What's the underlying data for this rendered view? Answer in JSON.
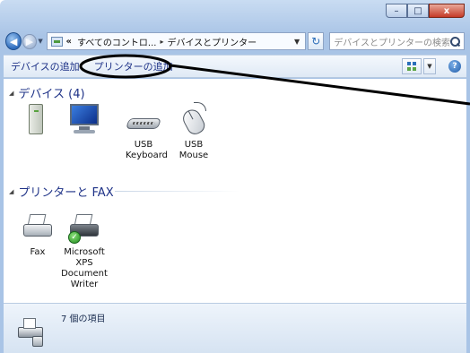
{
  "window": {
    "caption_buttons": {
      "minimize": "–",
      "maximize": "□",
      "close": "x"
    }
  },
  "nav": {
    "back_glyph": "◀",
    "forward_glyph": "▶",
    "history_drop_glyph": "▼"
  },
  "address": {
    "overflow_marker": "«",
    "crumbs": [
      "すべてのコントロ...",
      "デバイスとプリンター"
    ],
    "crumb_separator": "▸",
    "drop_glyph": "▼"
  },
  "refresh_glyph": "↻",
  "search": {
    "placeholder": "デバイスとプリンターの検索"
  },
  "command_bar": {
    "add_device": "デバイスの追加",
    "add_printer": "プリンターの追加",
    "view_drop_glyph": "▼",
    "help_glyph": "?"
  },
  "groups": {
    "devices": {
      "header": "デバイス (4)",
      "toggle_glyph": "◢",
      "items": [
        {
          "label": "",
          "icon": "computer-tower-icon"
        },
        {
          "label": "",
          "icon": "monitor-icon"
        },
        {
          "label": "USB Keyboard",
          "icon": "keyboard-icon"
        },
        {
          "label": "USB Mouse",
          "icon": "mouse-icon"
        }
      ]
    },
    "printers": {
      "header": "プリンターと FAX",
      "toggle_glyph": "◢",
      "items": [
        {
          "label": "Fax",
          "icon": "fax-icon"
        },
        {
          "label": "Microsoft XPS Document Writer",
          "icon": "printer-icon",
          "is_default": true,
          "default_glyph": "✓"
        }
      ]
    }
  },
  "status_bar": {
    "item_count": "7 個の項目"
  },
  "annotation": {
    "highlighted_target": "add-printer-command",
    "color": "#000000"
  },
  "colors": {
    "link": "#1e3287",
    "header_line": "#c9d6e6",
    "status_bg": "#d6e3f2"
  }
}
